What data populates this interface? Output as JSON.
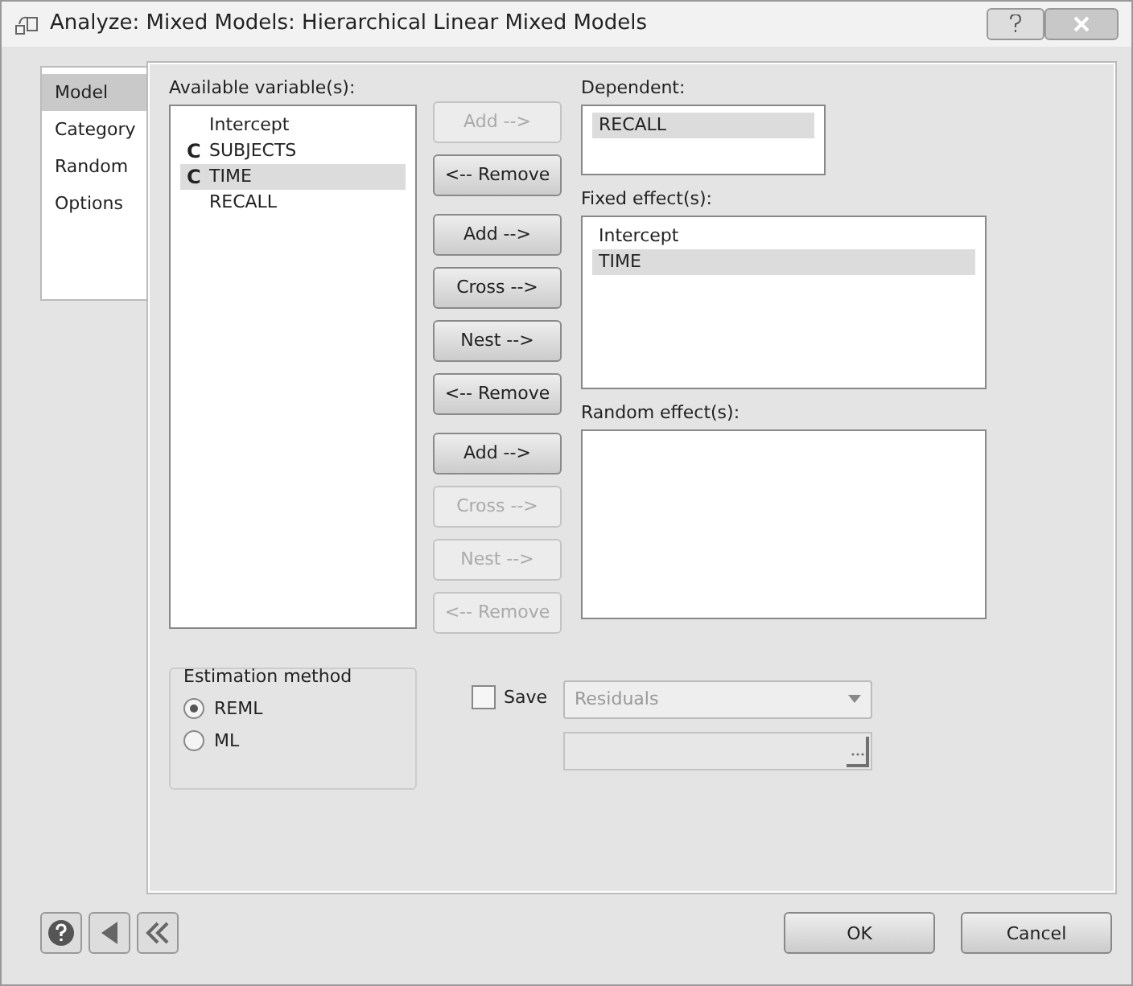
{
  "window": {
    "title": "Analyze: Mixed Models: Hierarchical Linear Mixed Models"
  },
  "tabs": [
    {
      "label": "Model",
      "selected": true
    },
    {
      "label": "Category",
      "selected": false
    },
    {
      "label": "Random",
      "selected": false
    },
    {
      "label": "Options",
      "selected": false
    }
  ],
  "available": {
    "label": "Available variable(s):",
    "items": [
      {
        "marker": "",
        "label": "Intercept",
        "selected": false
      },
      {
        "marker": "C",
        "label": "SUBJECTS",
        "selected": false
      },
      {
        "marker": "C",
        "label": "TIME",
        "selected": true
      },
      {
        "marker": "",
        "label": "RECALL",
        "selected": false
      }
    ]
  },
  "button_groups": [
    [
      {
        "label": "Add -->",
        "disabled": true
      },
      {
        "label": "<-- Remove",
        "disabled": false
      }
    ],
    [
      {
        "label": "Add -->",
        "disabled": false
      },
      {
        "label": "Cross -->",
        "disabled": false
      },
      {
        "label": "Nest -->",
        "disabled": false
      },
      {
        "label": "<-- Remove",
        "disabled": false
      }
    ],
    [
      {
        "label": "Add -->",
        "disabled": false
      },
      {
        "label": "Cross -->",
        "disabled": true
      },
      {
        "label": "Nest -->",
        "disabled": true
      },
      {
        "label": "<-- Remove",
        "disabled": true
      }
    ]
  ],
  "dependent": {
    "label": "Dependent:",
    "items": [
      {
        "label": "RECALL",
        "selected": true
      }
    ]
  },
  "fixed_effects": {
    "label": "Fixed effect(s):",
    "items": [
      {
        "label": "Intercept",
        "selected": false
      },
      {
        "label": "TIME",
        "selected": true
      }
    ]
  },
  "random_effects": {
    "label": "Random effect(s):"
  },
  "estimation": {
    "title": "Estimation method",
    "options": [
      {
        "label": "REML",
        "selected": true
      },
      {
        "label": "ML",
        "selected": false
      }
    ]
  },
  "save": {
    "label": "Save",
    "checked": false,
    "dropdown": {
      "value": "Residuals",
      "disabled": true
    },
    "file_field": {
      "disabled": true
    }
  },
  "footer": {
    "buttons": [
      {
        "label": "OK"
      },
      {
        "label": "Cancel"
      }
    ]
  }
}
